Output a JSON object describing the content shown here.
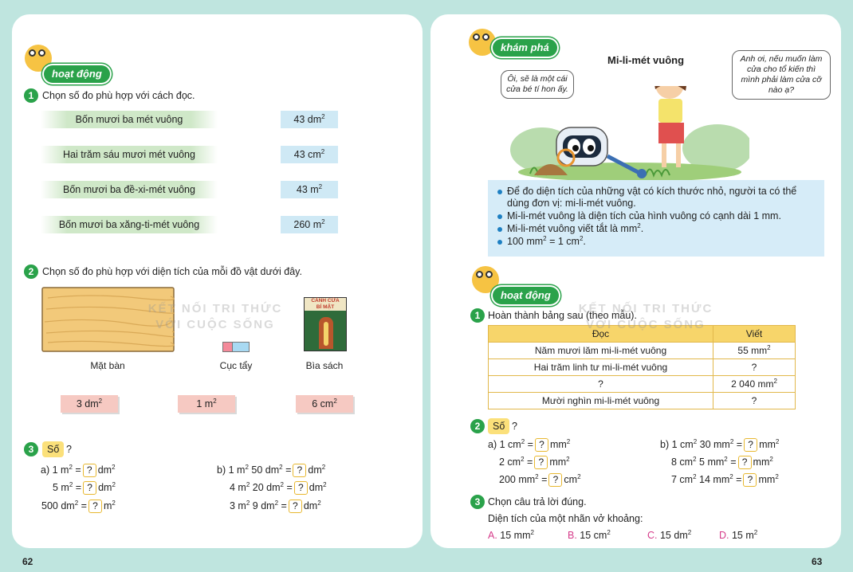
{
  "left": {
    "page_number": "62",
    "section_badge": "hoạt động",
    "q1": {
      "number": "1",
      "prompt": "Chọn số đo phù hợp với cách đọc.",
      "readings": [
        "Bốn mươi ba mét vuông",
        "Hai trăm sáu mươi mét vuông",
        "Bốn mươi ba đề-xi-mét vuông",
        "Bốn mươi ba xăng-ti-mét vuông"
      ],
      "measures": [
        {
          "value": "43 dm",
          "exp": "2"
        },
        {
          "value": "43 cm",
          "exp": "2"
        },
        {
          "value": "43 m",
          "exp": "2"
        },
        {
          "value": "260 m",
          "exp": "2"
        }
      ]
    },
    "q2": {
      "number": "2",
      "prompt": "Chọn số đo phù hợp với diện tích của mỗi đồ vật dưới đây.",
      "items": [
        "Mặt bàn",
        "Cục tẩy",
        "Bìa sách"
      ],
      "book_title_line1": "CÁNH CỬA",
      "book_title_line2": "BÍ MẬT",
      "options": [
        {
          "value": "3 dm",
          "exp": "2"
        },
        {
          "value": "1 m",
          "exp": "2"
        },
        {
          "value": "6 cm",
          "exp": "2"
        }
      ]
    },
    "q3": {
      "number": "3",
      "so_label": "Số",
      "qmark": "?",
      "a_label": "a)",
      "b_label": "b)",
      "a": [
        {
          "lhs": "1 m",
          "le": "2",
          "eq": "=",
          "box": "?",
          "unit": "dm",
          "ue": "2"
        },
        {
          "lhs": "5 m",
          "le": "2",
          "eq": "=",
          "box": "?",
          "unit": "dm",
          "ue": "2"
        },
        {
          "lhs": "500 dm",
          "le": "2",
          "eq": "=",
          "box": "?",
          "unit": "m",
          "ue": "2"
        }
      ],
      "b": [
        {
          "lhs1": "1 m",
          "le1": "2",
          "lhs2": "50 dm",
          "le2": "2",
          "eq": "=",
          "box": "?",
          "unit": "dm",
          "ue": "2"
        },
        {
          "lhs1": "4 m",
          "le1": "2",
          "lhs2": "20 dm",
          "le2": "2",
          "eq": "=",
          "box": "?",
          "unit": "dm",
          "ue": "2"
        },
        {
          "lhs1": "3 m",
          "le1": "2",
          "lhs2": "9 dm",
          "le2": "2",
          "eq": "=",
          "box": "?",
          "unit": "dm",
          "ue": "2"
        }
      ]
    }
  },
  "right": {
    "page_number": "63",
    "explore_badge": "khám phá",
    "title": "Mi-li-mét vuông",
    "bubble_robot": "Ôi, sẽ là một cái cửa bé tí hon ấy.",
    "bubble_girl": "Anh ơi, nếu muốn làm cửa cho tổ kiến thì mình phải làm cửa cỡ nào ạ?",
    "info": [
      {
        "text": "Để đo diện tích của những vật có kích thước nhỏ, người ta có thể dùng đơn vị: mi-li-mét vuông."
      },
      {
        "text": "Mi-li-mét vuông là diện tích của hình vuông có cạnh dài 1 mm."
      },
      {
        "text": "Mi-li-mét vuông viết tắt là mm",
        "exp": "2",
        "tail": "."
      },
      {
        "text": "100 mm",
        "exp": "2",
        "mid": " = 1 cm",
        "exp2": "2",
        "tail": "."
      }
    ],
    "section_badge": "hoạt động",
    "q1": {
      "number": "1",
      "prompt": "Hoàn thành bảng sau (theo mẫu).",
      "headers": [
        "Đọc",
        "Viết"
      ],
      "rows": [
        {
          "read": "Năm mươi lăm mi-li-mét vuông",
          "write": "55 mm",
          "exp": "2"
        },
        {
          "read": "Hai trăm linh tư mi-li-mét vuông",
          "write": "?",
          "exp": ""
        },
        {
          "read": "?",
          "write": "2 040 mm",
          "exp": "2"
        },
        {
          "read": "Mười nghìn mi-li-mét vuông",
          "write": "?",
          "exp": ""
        }
      ]
    },
    "q2": {
      "number": "2",
      "so_label": "Số",
      "qmark": "?",
      "a_label": "a)",
      "b_label": "b)",
      "a": [
        {
          "lhs": "1 cm",
          "le": "2",
          "eq": "=",
          "box": "?",
          "unit": "mm",
          "ue": "2"
        },
        {
          "lhs": "2 cm",
          "le": "2",
          "eq": "=",
          "box": "?",
          "unit": "mm",
          "ue": "2"
        },
        {
          "lhs": "200 mm",
          "le": "2",
          "eq": "=",
          "box": "?",
          "unit": "cm",
          "ue": "2"
        }
      ],
      "b": [
        {
          "lhs1": "1 cm",
          "le1": "2",
          "lhs2": "30 mm",
          "le2": "2",
          "eq": "=",
          "box": "?",
          "unit": "mm",
          "ue": "2"
        },
        {
          "lhs1": "8 cm",
          "le1": "2",
          "lhs2": "5 mm",
          "le2": "2",
          "eq": "=",
          "box": "?",
          "unit": "mm",
          "ue": "2"
        },
        {
          "lhs1": "7 cm",
          "le1": "2",
          "lhs2": "14 mm",
          "le2": "2",
          "eq": "=",
          "box": "?",
          "unit": "mm",
          "ue": "2"
        }
      ]
    },
    "q3": {
      "number": "3",
      "prompt": "Chọn câu trả lời đúng.",
      "sub": "Diện tích của một nhãn vở khoảng:",
      "choices": [
        {
          "letter": "A.",
          "value": "15 mm",
          "exp": "2"
        },
        {
          "letter": "B.",
          "value": "15 cm",
          "exp": "2"
        },
        {
          "letter": "C.",
          "value": "15 dm",
          "exp": "2"
        },
        {
          "letter": "D.",
          "value": "15 m",
          "exp": "2"
        }
      ]
    }
  },
  "watermark": {
    "line1": "KẾT NỐI TRI THỨC",
    "line2": "VỚI CUỘC SỐNG"
  },
  "colors": {
    "green": "#2aa24a",
    "page_bg": "#bfe5df",
    "blue_box": "#cfe9f5",
    "pink_box": "#f6c9c2",
    "yellow": "#fbe07a"
  }
}
